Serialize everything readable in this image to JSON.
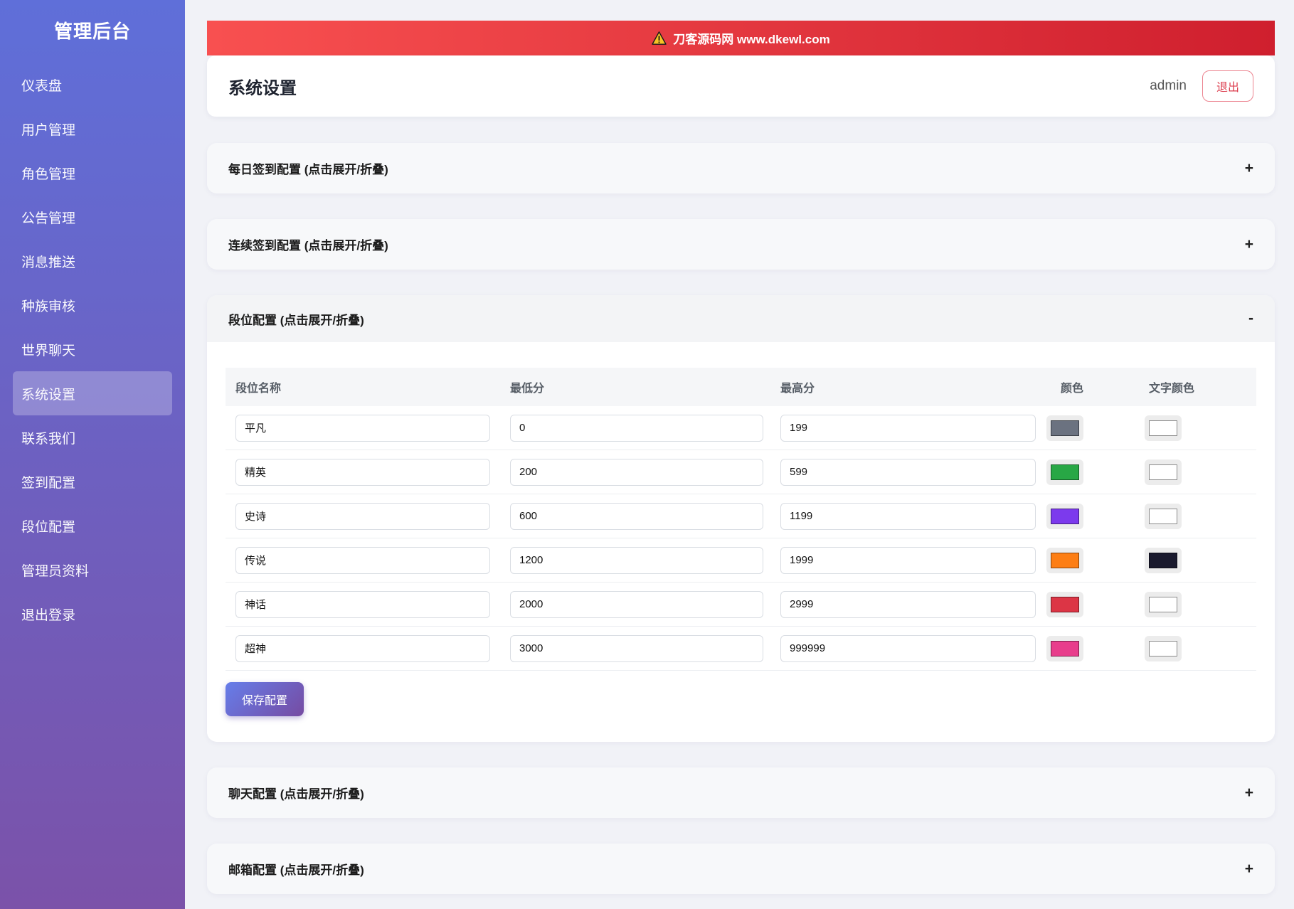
{
  "sidebar": {
    "title": "管理后台",
    "items": [
      {
        "label": "仪表盘",
        "active": false
      },
      {
        "label": "用户管理",
        "active": false
      },
      {
        "label": "角色管理",
        "active": false
      },
      {
        "label": "公告管理",
        "active": false
      },
      {
        "label": "消息推送",
        "active": false
      },
      {
        "label": "种族审核",
        "active": false
      },
      {
        "label": "世界聊天",
        "active": false
      },
      {
        "label": "系统设置",
        "active": true
      },
      {
        "label": "联系我们",
        "active": false
      },
      {
        "label": "签到配置",
        "active": false
      },
      {
        "label": "段位配置",
        "active": false
      },
      {
        "label": "管理员资料",
        "active": false
      },
      {
        "label": "退出登录",
        "active": false
      }
    ]
  },
  "banner": {
    "text": "刀客源码网 www.dkewl.com",
    "icon": "warning-icon"
  },
  "header": {
    "title": "系统设置",
    "username": "admin",
    "logout_label": "退出"
  },
  "sections": [
    {
      "title": "每日签到配置 (点击展开/折叠)",
      "toggle": "+"
    },
    {
      "title": "连续签到配置 (点击展开/折叠)",
      "toggle": "+"
    },
    {
      "title": "段位配置 (点击展开/折叠)",
      "toggle": "-"
    },
    {
      "title": "聊天配置 (点击展开/折叠)",
      "toggle": "+"
    },
    {
      "title": "邮箱配置 (点击展开/折叠)",
      "toggle": "+"
    }
  ],
  "rank_table": {
    "columns": [
      "段位名称",
      "最低分",
      "最高分",
      "颜色",
      "文字颜色"
    ],
    "rows": [
      {
        "name": "平凡",
        "min": "0",
        "max": "199",
        "color": "#6b7280",
        "text_color": "#ffffff"
      },
      {
        "name": "精英",
        "min": "200",
        "max": "599",
        "color": "#28a745",
        "text_color": "#ffffff"
      },
      {
        "name": "史诗",
        "min": "600",
        "max": "1199",
        "color": "#7c3aed",
        "text_color": "#ffffff"
      },
      {
        "name": "传说",
        "min": "1200",
        "max": "1999",
        "color": "#fd7e14",
        "text_color": "#1a1a2e"
      },
      {
        "name": "神话",
        "min": "2000",
        "max": "2999",
        "color": "#dc3545",
        "text_color": "#ffffff"
      },
      {
        "name": "超神",
        "min": "3000",
        "max": "999999",
        "color": "#e83e8c",
        "text_color": "#ffffff"
      }
    ],
    "save_label": "保存配置"
  },
  "theme": {
    "sidebar_gradient_top": "#5f6fd9",
    "sidebar_gradient_bottom": "#7b52a9",
    "banner_red_left": "#f85050",
    "banner_red_right": "#cf1f2e",
    "accent_gradient_left": "#667eea",
    "accent_gradient_right": "#764ba2",
    "logout_red": "#dc3d4e",
    "warning_yellow": "#f7c325"
  }
}
